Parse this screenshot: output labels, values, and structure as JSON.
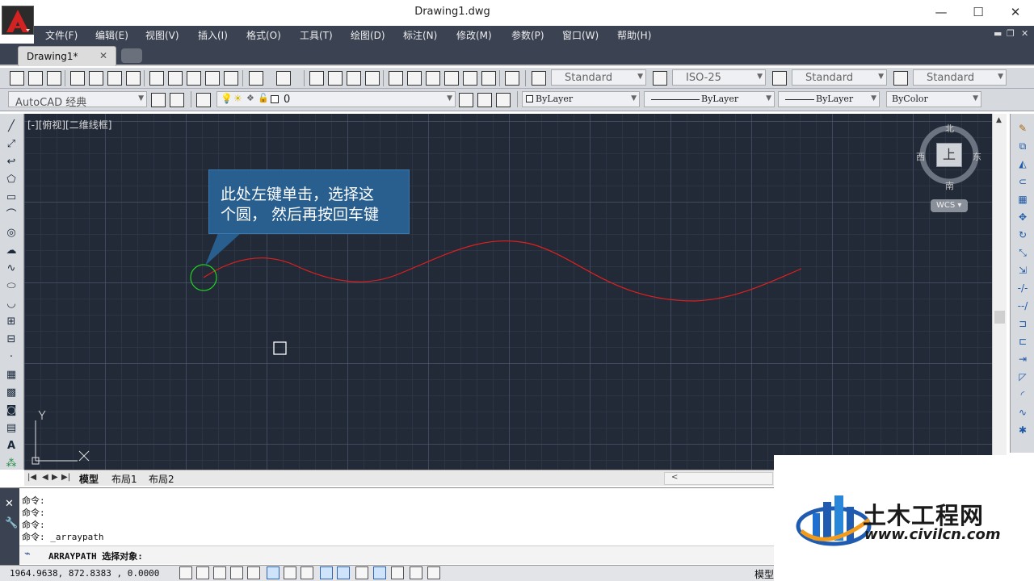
{
  "window": {
    "title": "Drawing1.dwg",
    "controls": {
      "minimize": "—",
      "maximize": "☐",
      "close": "✕"
    }
  },
  "menu": {
    "items": [
      "文件(F)",
      "编辑(E)",
      "视图(V)",
      "插入(I)",
      "格式(O)",
      "工具(T)",
      "绘图(D)",
      "标注(N)",
      "修改(M)",
      "参数(P)",
      "窗口(W)",
      "帮助(H)"
    ]
  },
  "tabs": {
    "document": "Drawing1*",
    "close": "✕"
  },
  "toolbar": {
    "text_style": "Standard",
    "dim_style": "ISO-25",
    "table_style": "Standard",
    "multileader_style": "Standard",
    "workspace": "AutoCAD 经典",
    "layer": "0",
    "color": "ByLayer",
    "linetype": "ByLayer",
    "lineweight": "ByLayer",
    "plot_style": "ByColor"
  },
  "viewport": {
    "label": "[-][俯视][二维线框]"
  },
  "callout": {
    "line1": "此处左键单击，选择这",
    "line2": "个圆， 然后再按回车键"
  },
  "viewcube": {
    "north": "北",
    "south": "南",
    "east": "东",
    "west": "西",
    "face": "上",
    "wcs": "WCS"
  },
  "ucs": {
    "x": "X",
    "y": "Y"
  },
  "layout_tabs": [
    "模型",
    "布局1",
    "布局2"
  ],
  "command": {
    "history": [
      "命令:",
      "命令:",
      "命令:",
      "命令: _arraypath"
    ],
    "prompt": "ARRAYPATH 选择对象:"
  },
  "status": {
    "coordinates": "1964.9638, 872.8383 , 0.0000",
    "model": "模型"
  },
  "watermark": {
    "name": "土木工程网",
    "url": "www.civilcn.com"
  },
  "colors": {
    "canvas_bg": "#222937",
    "spline": "#e0201e",
    "circle": "#22d422",
    "callout": "#285f8f",
    "menubar": "#3b4252"
  }
}
